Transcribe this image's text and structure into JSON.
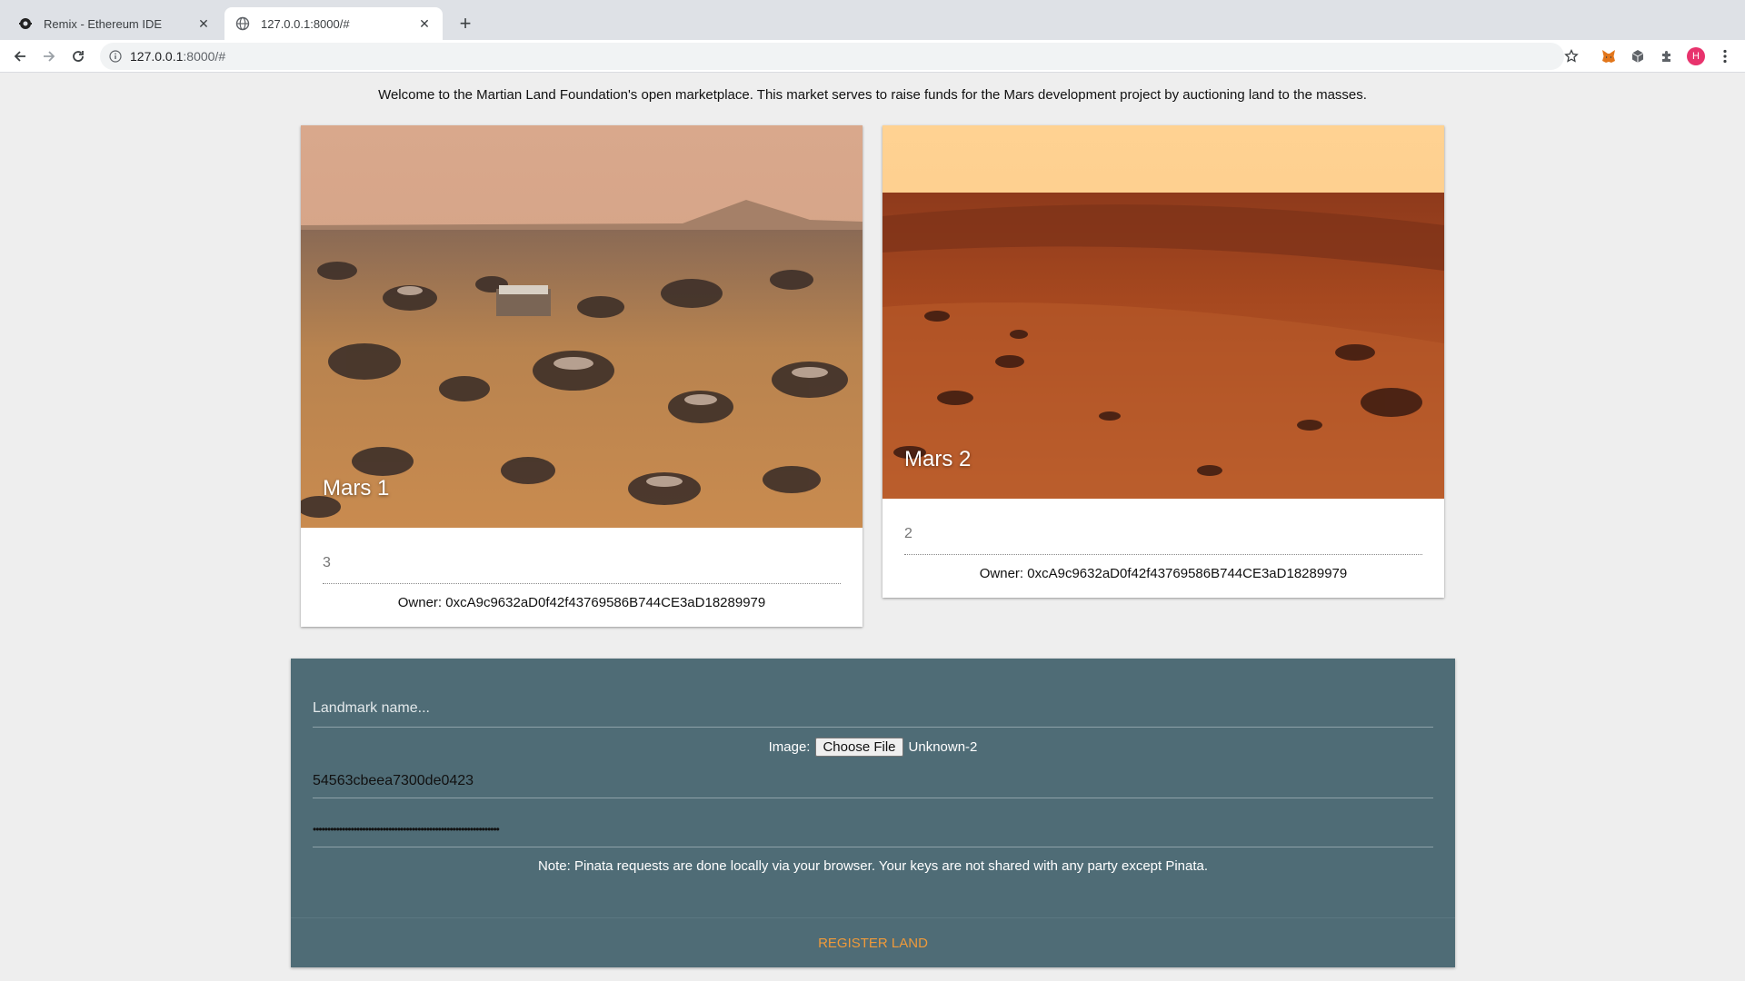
{
  "browser": {
    "tabs": [
      {
        "title": "Remix - Ethereum IDE",
        "icon": "remix-logo-icon",
        "active": false
      },
      {
        "title": "127.0.0.1:8000/#",
        "icon": "globe-icon",
        "active": true
      }
    ],
    "url_host": "127.0.0.1",
    "url_rest": ":8000/#",
    "profile_initial": "H"
  },
  "page": {
    "welcome": "Welcome to the Martian Land Foundation's open marketplace. This market serves to raise funds for the Mars development project by auctioning land to the masses.",
    "cards": [
      {
        "title": "Mars 1",
        "price": "3",
        "owner": "Owner: 0xcA9c9632aD0f42f43769586B744CE3aD18289979"
      },
      {
        "title": "Mars 2",
        "price": "2",
        "owner": "Owner: 0xcA9c9632aD0f42f43769586B744CE3aD18289979"
      }
    ],
    "form": {
      "name_placeholder": "Landmark name...",
      "image_label": "Image:",
      "choose_file": "Choose File",
      "file_name": "Unknown-2",
      "api_key": "54563cbeea7300de0423",
      "secret_mask": "••••••••••••••••••••••••••••••••••••••••••••••••••••••••••••••••",
      "note": "Note: Pinata requests are done locally via your browser. Your keys are not shared with any party except Pinata.",
      "submit": "REGISTER LAND"
    }
  },
  "colors": {
    "page_bg": "#eeeeee",
    "form_bg": "#4f6c76",
    "accent": "#ef9a3a",
    "profile": "#e8336d"
  }
}
